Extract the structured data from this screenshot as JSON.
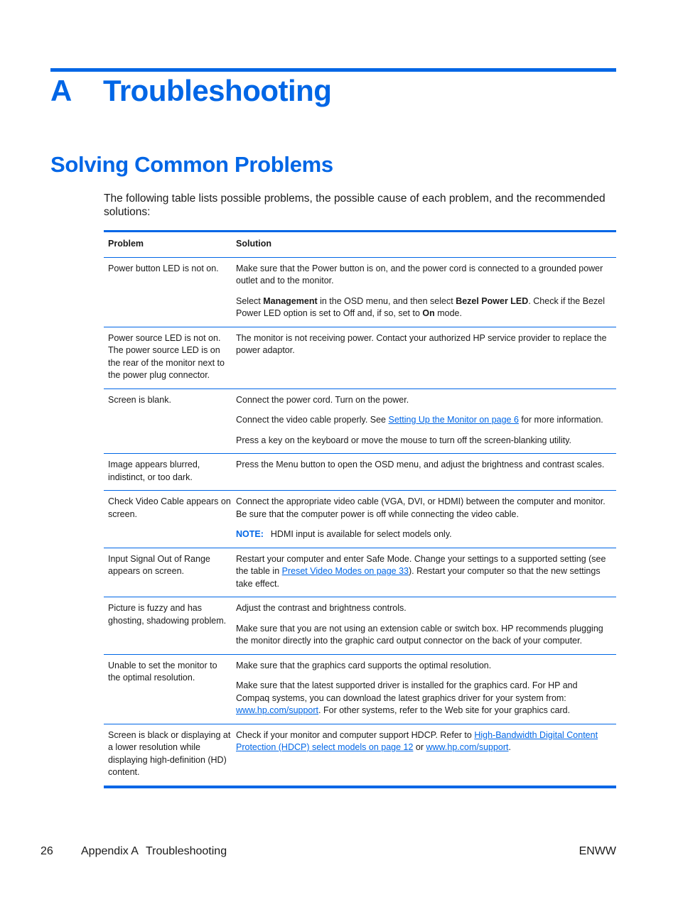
{
  "chapter": {
    "letter": "A",
    "title": "Troubleshooting"
  },
  "section": {
    "title": "Solving Common Problems"
  },
  "intro": "The following table lists possible problems, the possible cause of each problem, and the recommended solutions:",
  "table": {
    "headers": {
      "problem": "Problem",
      "solution": "Solution"
    },
    "rows": [
      {
        "problem": "Power button LED is not on.",
        "s1": "Make sure that the Power button is on, and the power cord is connected to a grounded power outlet and to the monitor.",
        "s2a": "Select ",
        "s2b": "Management",
        "s2c": " in the OSD menu, and then select ",
        "s2d": "Bezel Power LED",
        "s2e": ". Check if the Bezel Power LED option is set to Off and, if so, set to ",
        "s2f": "On",
        "s2g": " mode."
      },
      {
        "problem": "Power source LED is not on. The power source LED is on the rear of the monitor next to the power plug connector.",
        "s1": "The monitor is not receiving power. Contact your authorized HP service provider to replace the power adaptor."
      },
      {
        "problem": "Screen is blank.",
        "s1": "Connect the power cord. Turn on the power.",
        "s2a": "Connect the video cable properly. See ",
        "s2link": "Setting Up the Monitor on page 6",
        "s2b": " for more information.",
        "s3": "Press a key on the keyboard or move the mouse to turn off the screen-blanking utility."
      },
      {
        "problem": "Image appears blurred, indistinct, or too dark.",
        "s1": "Press the Menu button to open the OSD menu, and adjust the brightness and contrast scales."
      },
      {
        "problem": "Check Video Cable appears on screen.",
        "s1": "Connect the appropriate video cable (VGA, DVI, or HDMI) between the computer and monitor. Be sure that the computer power is off while connecting the video cable.",
        "note_label": "NOTE:",
        "note_text": "HDMI input is available for select models only."
      },
      {
        "problem": "Input Signal Out of Range appears on screen.",
        "s1a": "Restart your computer and enter Safe Mode. Change your settings to a supported setting (see the table in ",
        "s1link": "Preset Video Modes on page 33",
        "s1b": "). Restart your computer so that the new settings take effect."
      },
      {
        "problem": "Picture is fuzzy and has ghosting, shadowing problem.",
        "s1": "Adjust the contrast and brightness controls.",
        "s2": "Make sure that you are not using an extension cable or switch box. HP recommends plugging the monitor directly into the graphic card output connector on the back of your computer."
      },
      {
        "problem": "Unable to set the monitor to the optimal resolution.",
        "s1": "Make sure that the graphics card supports the optimal resolution.",
        "s2a": "Make sure that the latest supported driver is installed for the graphics card. For HP and Compaq systems, you can download the latest graphics driver for your system from: ",
        "s2link": "www.hp.com/support",
        "s2b": ". For other systems, refer to the Web site for your graphics card."
      },
      {
        "problem": "Screen is black or displaying at a lower resolution while displaying high-definition (HD) content.",
        "s1a": "Check if your monitor and computer support HDCP. Refer to ",
        "s1link1": "High-Bandwidth Digital Content Protection (HDCP) select models on page 12",
        "s1b": " or ",
        "s1link2": "www.hp.com/support",
        "s1c": "."
      }
    ]
  },
  "footer": {
    "page_number": "26",
    "appendix": "Appendix A",
    "chapter": "Troubleshooting",
    "code": "ENWW"
  },
  "colors": {
    "accent": "#0066e6",
    "text": "#1a1a1a"
  }
}
